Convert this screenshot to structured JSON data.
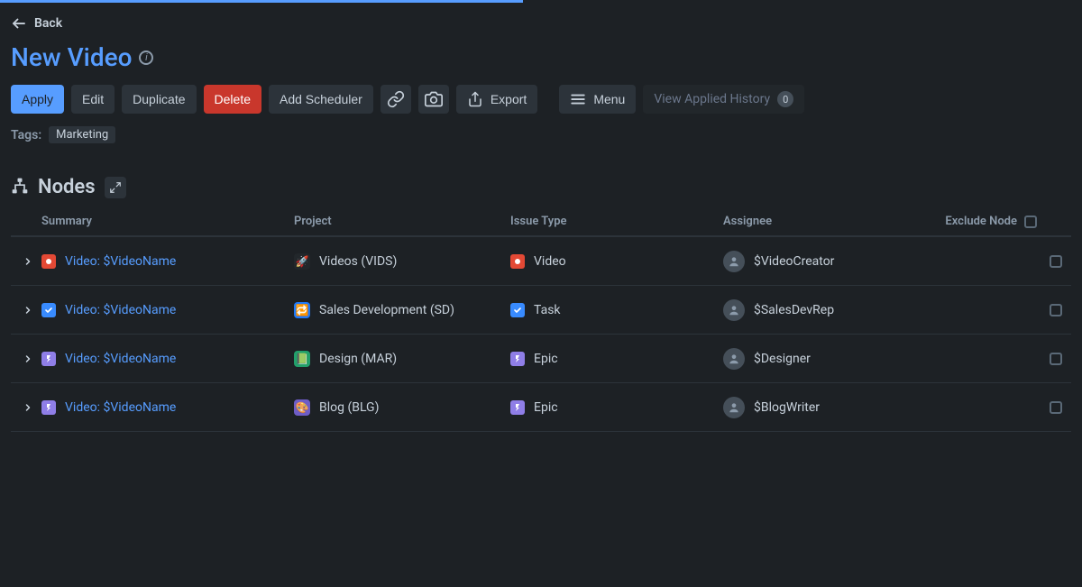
{
  "nav": {
    "back_label": "Back"
  },
  "title": "New Video",
  "toolbar": {
    "apply": "Apply",
    "edit": "Edit",
    "duplicate": "Duplicate",
    "delete": "Delete",
    "add_scheduler": "Add Scheduler",
    "export": "Export",
    "menu": "Menu",
    "history_label": "View Applied History",
    "history_count": "0"
  },
  "tags": {
    "label": "Tags:",
    "items": [
      "Marketing"
    ]
  },
  "nodes": {
    "section_title": "Nodes",
    "columns": {
      "summary": "Summary",
      "project": "Project",
      "issue_type": "Issue Type",
      "assignee": "Assignee",
      "exclude": "Exclude Node"
    },
    "rows": [
      {
        "summary": "Video: $VideoName",
        "summary_icon": "video",
        "project": "Videos (VIDS)",
        "project_avatar": "rocket",
        "project_emoji": "🚀",
        "issue_type": "Video",
        "issue_icon": "video",
        "assignee": "$VideoCreator",
        "excluded": false
      },
      {
        "summary": "Video: $VideoName",
        "summary_icon": "task",
        "project": "Sales Development (SD)",
        "project_avatar": "sd",
        "project_emoji": "🔁",
        "issue_type": "Task",
        "issue_icon": "task",
        "assignee": "$SalesDevRep",
        "excluded": false
      },
      {
        "summary": "Video: $VideoName",
        "summary_icon": "epic",
        "project": "Design (MAR)",
        "project_avatar": "design",
        "project_emoji": "📗",
        "issue_type": "Epic",
        "issue_icon": "epic",
        "assignee": "$Designer",
        "excluded": false
      },
      {
        "summary": "Video: $VideoName",
        "summary_icon": "epic",
        "project": "Blog (BLG)",
        "project_avatar": "blog",
        "project_emoji": "🎨",
        "issue_type": "Epic",
        "issue_icon": "epic",
        "assignee": "$BlogWriter",
        "excluded": false
      }
    ]
  }
}
